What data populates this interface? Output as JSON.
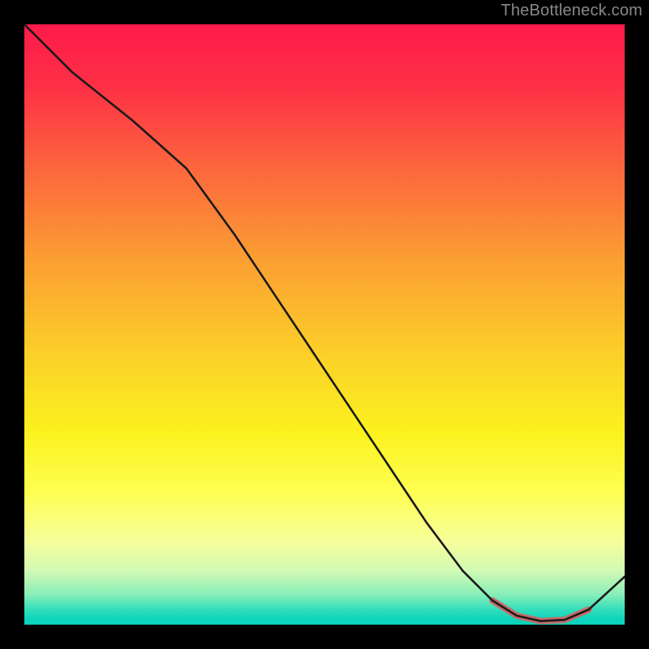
{
  "attribution": "TheBottleneck.com",
  "chart_data": {
    "type": "line",
    "title": "",
    "xlabel": "",
    "ylabel": "",
    "xlim": [
      0,
      100
    ],
    "ylim": [
      0,
      100
    ],
    "background_gradient_stops": [
      {
        "t": 0.0,
        "color": "#fd1a4a"
      },
      {
        "t": 0.1,
        "color": "#fd2f46"
      },
      {
        "t": 0.25,
        "color": "#fc6a3c"
      },
      {
        "t": 0.4,
        "color": "#fba132"
      },
      {
        "t": 0.55,
        "color": "#fbd028"
      },
      {
        "t": 0.68,
        "color": "#fbf21e"
      },
      {
        "t": 0.78,
        "color": "#feff52"
      },
      {
        "t": 0.86,
        "color": "#f6ff9a"
      },
      {
        "t": 0.91,
        "color": "#d2fab4"
      },
      {
        "t": 0.95,
        "color": "#87eeb8"
      },
      {
        "t": 0.975,
        "color": "#33debb"
      },
      {
        "t": 0.99,
        "color": "#0fd5bd"
      },
      {
        "t": 1.0,
        "color": "#0ad3bd"
      }
    ],
    "series": [
      {
        "name": "bottleneck-curve",
        "color": "#1a1a1a",
        "width": 2.6,
        "x": [
          0,
          8,
          18,
          27,
          35,
          43,
          51,
          59,
          67,
          73,
          78,
          82,
          86,
          90,
          94,
          100
        ],
        "values": [
          100,
          92,
          84,
          76,
          65,
          53,
          41,
          29,
          17,
          9,
          4,
          1.5,
          0.6,
          0.8,
          2.5,
          8
        ]
      }
    ],
    "highlight_segment": {
      "name": "optimal-zone",
      "color": "#c76a6a",
      "width": 8,
      "x": [
        78,
        82,
        86,
        90,
        94
      ],
      "values": [
        4,
        1.5,
        0.6,
        0.8,
        2.5
      ]
    }
  }
}
